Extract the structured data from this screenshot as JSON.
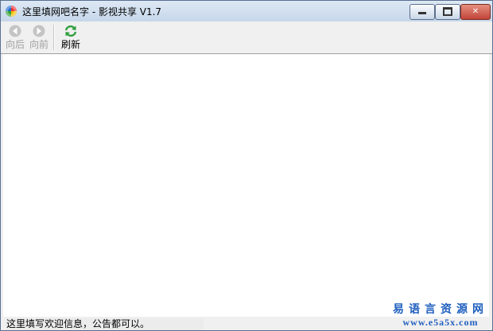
{
  "window": {
    "title": "这里填网吧名字  -  影视共享 V1.7",
    "controls": {
      "minimize": "minimize",
      "maximize": "maximize",
      "close": "✕"
    }
  },
  "toolbar": {
    "back_label": "向后",
    "forward_label": "向前",
    "refresh_label": "刷新"
  },
  "statusbar": {
    "text": "这里填写欢迎信息，公告都可以。"
  },
  "watermark": {
    "name": "易语言资源网",
    "url": "www.e5a5x.com"
  },
  "colors": {
    "titlebar": "#c6d7ea",
    "disabled_arrow": "#b5b5b5",
    "refresh_green": "#2e9e3b",
    "watermark": "#1f5fbf"
  }
}
